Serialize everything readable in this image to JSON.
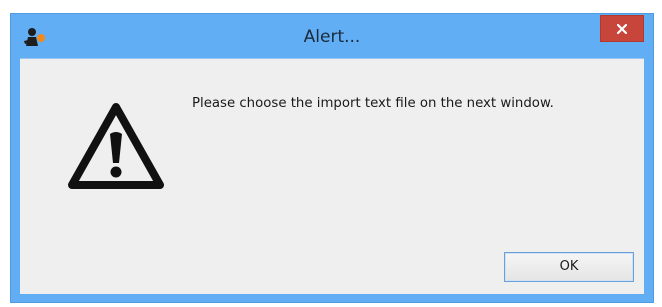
{
  "window": {
    "title": "Alert...",
    "app_icon": "app-logo-icon",
    "close_icon": "close-icon"
  },
  "dialog": {
    "icon": "warning-icon",
    "message": "Please choose the import text file on the next window.",
    "ok_label": "OK"
  },
  "colors": {
    "titlebar": "#62aef5",
    "close_button": "#c7453a",
    "client_background": "#efefef",
    "button_border": "#6a9fd8"
  }
}
